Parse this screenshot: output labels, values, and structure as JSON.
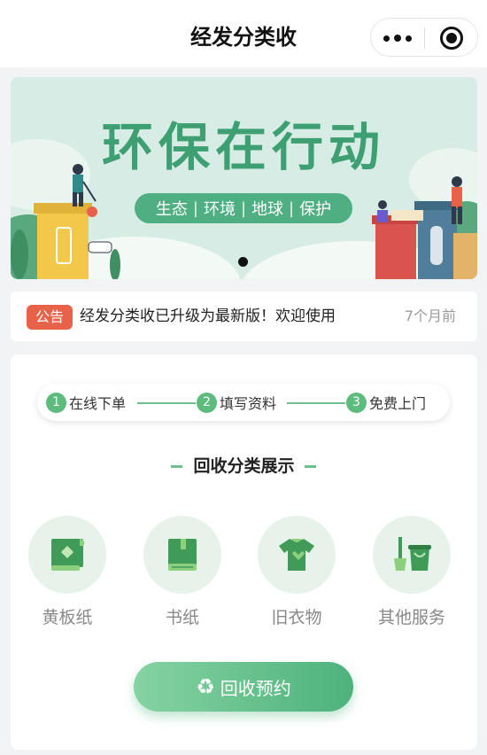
{
  "nav": {
    "title": "经发分类收"
  },
  "banner": {
    "title": "环保在行动",
    "tags": [
      "生态",
      "环境",
      "地球",
      "保护"
    ],
    "sep": "|"
  },
  "notice": {
    "badge": "公告",
    "text": "经发分类收已升级为最新版！欢迎使用",
    "time": "7个月前"
  },
  "steps": [
    {
      "num": "1",
      "label": "在线下单"
    },
    {
      "num": "2",
      "label": "填写资料"
    },
    {
      "num": "3",
      "label": "免费上门"
    }
  ],
  "section": {
    "title": "回收分类展示"
  },
  "categories": [
    {
      "label": "黄板纸",
      "icon": "cardboard-icon"
    },
    {
      "label": "书纸",
      "icon": "book-icon"
    },
    {
      "label": "旧衣物",
      "icon": "clothes-icon"
    },
    {
      "label": "其他服务",
      "icon": "trash-tools-icon"
    }
  ],
  "button": {
    "label": "回收预约",
    "icon": "recycle-icon"
  },
  "colors": {
    "accent": "#4db27c",
    "badge": "#e8624a",
    "banner_bg": "#d6ece4"
  }
}
